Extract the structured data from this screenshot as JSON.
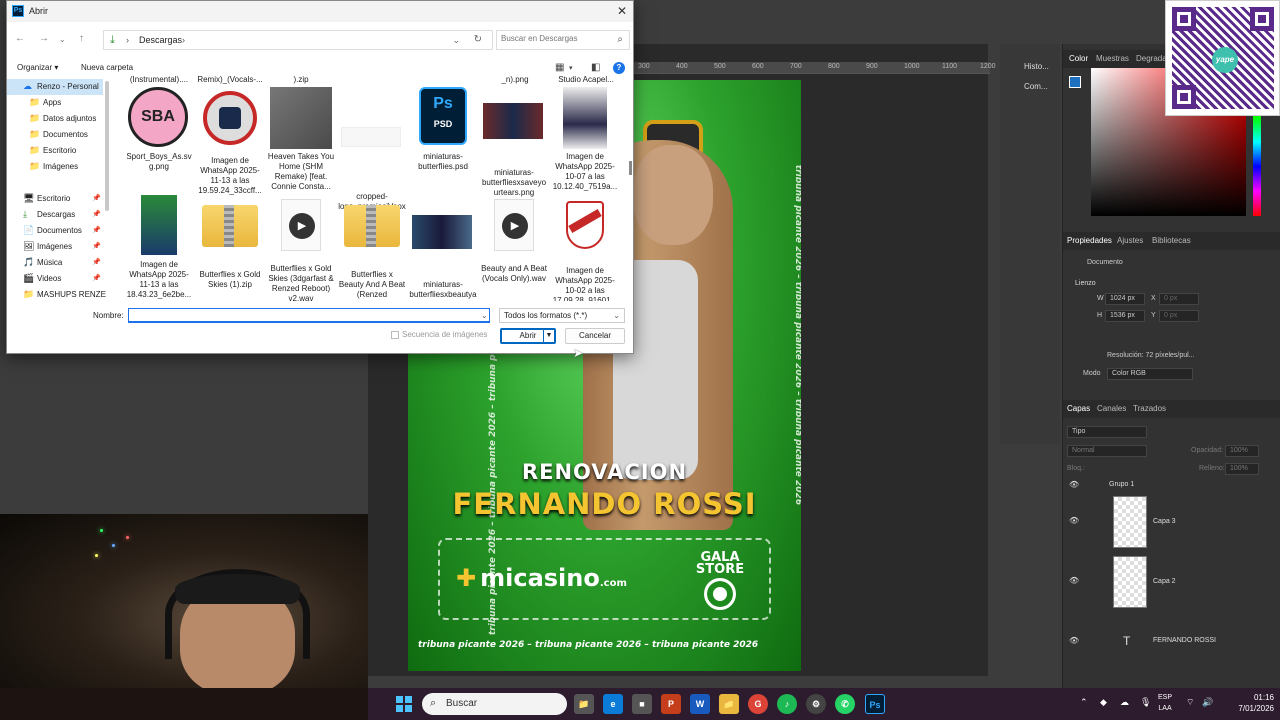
{
  "photoshop": {
    "ruler_numbers": [
      "300",
      "400",
      "500",
      "600",
      "700",
      "800",
      "900",
      "1000",
      "1100",
      "1200",
      "1300"
    ],
    "mid_items": [
      "Histo...",
      "Com..."
    ],
    "color_tabs": [
      "Color",
      "Muestras",
      "Degradad"
    ],
    "prop_tabs": [
      "Propiedades",
      "Ajustes",
      "Bibliotecas"
    ],
    "doc_label": "Documento",
    "canvas_section": "Lienzo",
    "width_label": "W",
    "width_val": "1024 px",
    "height_label": "H",
    "height_val": "1536 px",
    "x_label": "X",
    "x_val": "0 px",
    "y_label": "Y",
    "y_val": "0 px",
    "resolution": "Resolución: 72 píxeles/pul...",
    "mode_label": "Modo",
    "mode_val": "Color RGB",
    "layer_tabs": [
      "Capas",
      "Canales",
      "Trazados"
    ],
    "filter_kind": "Tipo",
    "blend_mode": "Normal",
    "opacity_label": "Opacidad:",
    "opacity_val": "100%",
    "lock_label": "Bloq.:",
    "fill_label": "Relleno:",
    "fill_val": "100%",
    "layers": [
      {
        "name": "Grupo 1"
      },
      {
        "name": "Capa 3"
      },
      {
        "name": "Capa 2"
      },
      {
        "name": "FERNANDO ROSSI"
      }
    ],
    "qr_brand": "yape"
  },
  "poster": {
    "vertical_text": "tribuna picante 2026 – tribuna picante 2026 – tribuna picante 2026",
    "subtitle": "RENOVACION",
    "title": "FERNANDO ROSSI",
    "sponsor1": "micasino",
    "sponsor1_suffix": ".com",
    "sponsor2": "GALA STORE",
    "bottom_text": "tribuna picante 2026 – tribuna picante 2026 – tribuna picante 2026"
  },
  "dialog": {
    "title": "Abrir",
    "close": "✕",
    "address": {
      "location": "Descargas"
    },
    "search_placeholder": "Buscar en Descargas",
    "toolbar": {
      "organize": "Organizar ▾",
      "new_folder": "Nueva carpeta"
    },
    "nav": [
      {
        "icon": "☁",
        "label": "Renzo - Personal",
        "sel": true
      },
      {
        "icon": "📁",
        "label": "Apps"
      },
      {
        "icon": "📁",
        "label": "Datos adjuntos"
      },
      {
        "icon": "📁",
        "label": "Documentos"
      },
      {
        "icon": "📁",
        "label": "Escritorio"
      },
      {
        "icon": "📁",
        "label": "Imágenes"
      },
      {
        "icon": "🖥",
        "label": "Escritorio",
        "pin": true
      },
      {
        "icon": "⬇",
        "label": "Descargas",
        "pin": true
      },
      {
        "icon": "📄",
        "label": "Documentos",
        "pin": true
      },
      {
        "icon": "🖼",
        "label": "Imágenes",
        "pin": true
      },
      {
        "icon": "🎵",
        "label": "Música",
        "pin": true
      },
      {
        "icon": "🎬",
        "label": "Videos",
        "pin": true
      },
      {
        "icon": "📁",
        "label": "MASHUPS RENZE"
      }
    ],
    "partial_names": [
      "(Instrumental)....",
      "Remix)_(Vocals-...",
      ").zip",
      "",
      "",
      "_n).png",
      "Studio Acapel..."
    ],
    "files_row1": [
      {
        "name": "Sport_Boys_As.svg.png",
        "kind": "sba"
      },
      {
        "name": "Imagen de WhatsApp 2025-11-13 a las 19.59.24_33ccff...",
        "kind": "crest"
      },
      {
        "name": "Heaven Takes You Home (SHM Remake) [feat. Connie Consta...",
        "kind": "grey"
      },
      {
        "name": "cropped-logo_premiosiVoox.png",
        "kind": "blank"
      },
      {
        "name": "miniaturas-butterflies.psd",
        "kind": "psd"
      },
      {
        "name": "miniaturas-butterfliesxsaveyourtears.png",
        "kind": "thumb"
      },
      {
        "name": "Imagen de WhatsApp 2025-10-07 a las 10.12.40_7519a...",
        "kind": "girl"
      }
    ],
    "files_row2": [
      {
        "name": "Imagen de WhatsApp 2025-11-13 a las 18.43.23_6e2be...",
        "kind": "player"
      },
      {
        "name": "Butterflies x Gold Skies (1).zip",
        "kind": "zip"
      },
      {
        "name": "Butterflies x Gold Skies (3dgarfast & Renzed Reboot) v2.wav",
        "kind": "wav"
      },
      {
        "name": "Butterflies x Beauty And A Beat (Renzed Mashup).zip",
        "kind": "zip"
      },
      {
        "name": "miniaturas-butterfliesxbeautyandabeat.png",
        "kind": "thumb"
      },
      {
        "name": "Beauty and A Beat (Vocals Only).wav",
        "kind": "wav"
      },
      {
        "name": "Imagen de WhatsApp 2025-10-02 a las 17.09.28_91601...",
        "kind": "river"
      }
    ],
    "psd_label": "PSD",
    "name_label": "Nombre:",
    "name_value": "",
    "filter_value": "Todos los formatos (*.*)",
    "sequence_label": "Secuencia de imágenes",
    "open_label": "Abrir",
    "cancel_label": "Cancelar"
  },
  "taskbar": {
    "search_label": "Buscar",
    "apps": [
      "📁",
      "e",
      "■",
      "P",
      "W",
      "📁",
      "G",
      "♪",
      "⚙",
      "✆",
      "Ps"
    ],
    "lang1": "ESP",
    "lang2": "LAA",
    "time": "01:16",
    "date": "7/01/2026"
  },
  "colors": {
    "accent": "#0067c0",
    "poster_green": "#2da32d",
    "title_gold": "#f5c531"
  }
}
